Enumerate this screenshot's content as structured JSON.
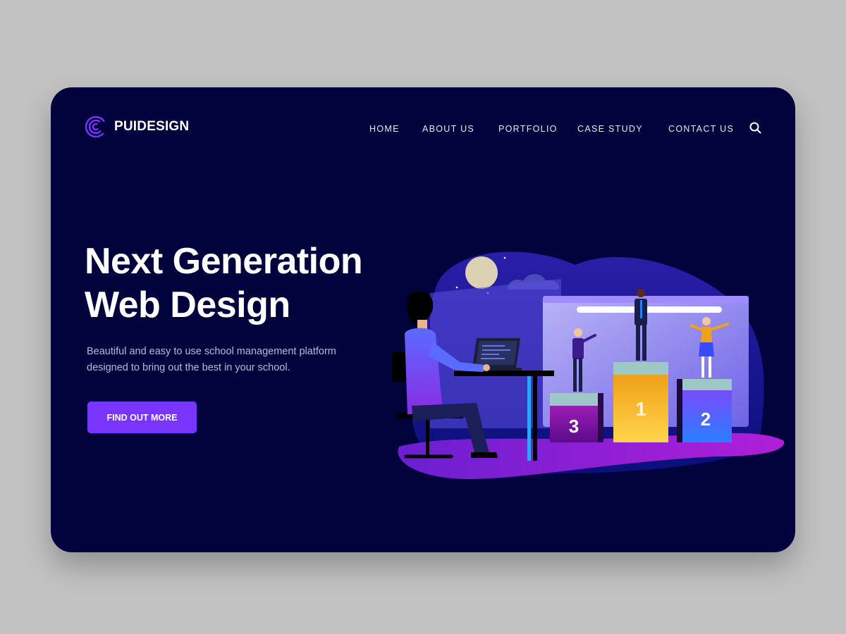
{
  "brand": {
    "name": "PUIDESIGN",
    "logo_icon": "spiral-c-logo-icon"
  },
  "nav": {
    "items": [
      "HOME",
      "ABOUT US",
      "PORTFOLIO",
      "CASE STUDY",
      "CONTACT US"
    ],
    "search_icon": "search-icon"
  },
  "hero": {
    "title_line1": "Next Generation",
    "title_line2": "Web Design",
    "description": "Beautiful and easy to use school management platform designed to bring out the best in your school.",
    "cta_label": "FIND OUT MORE"
  },
  "illustration": {
    "podium_labels": [
      "1",
      "2",
      "3"
    ]
  },
  "colors": {
    "page_bg": "#c2c2c2",
    "card_bg": "#02033d",
    "accent": "#7a34ff",
    "text_primary": "#ffffff",
    "text_secondary": "#b8bad8"
  }
}
